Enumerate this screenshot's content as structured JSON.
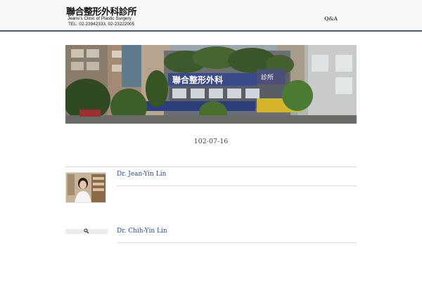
{
  "header": {
    "logo_title": "聯合整形外科診所",
    "logo_subtitle": "Jeans’s Clinic of Plastic Surgery",
    "logo_tel": "TEL: 02-23942333, 02-23222005",
    "nav": [
      {
        "label": "Q&A"
      }
    ],
    "border_color": "#44617a"
  },
  "hero": {
    "sign_text": "聯合整形外科",
    "sign_side_text": "診所"
  },
  "post": {
    "date": "102-07-16"
  },
  "doctors": [
    {
      "name": "Dr. Jean-Yin Lin"
    },
    {
      "name": "Dr. Chih-Yin Lin"
    }
  ],
  "colors": {
    "link": "#2b4a7a"
  }
}
